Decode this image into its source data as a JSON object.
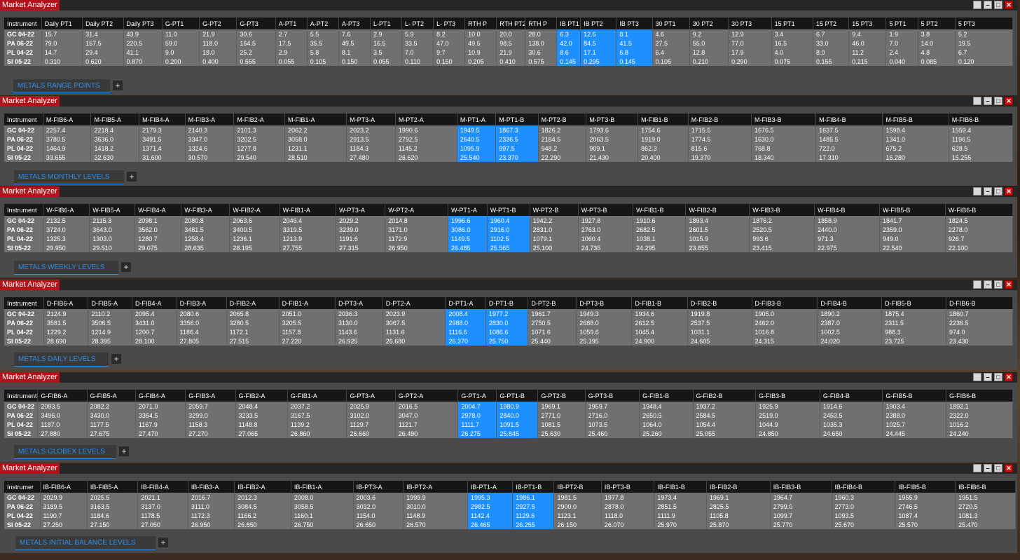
{
  "app_title": "Market Analyzer",
  "window_controls": {
    "restore": "",
    "minimize": "–",
    "maximize": "□",
    "close": "✕"
  },
  "panels": [
    {
      "tab": "METALS RANGE POINTS",
      "headers": [
        "Instrument",
        "Daily PT1",
        "Daily PT2",
        "Daily PT3",
        "G-PT1",
        "G-PT2",
        "G-PT3",
        "A-PT1",
        "A-PT2",
        "A-PT3",
        "L-PT1",
        "L- PT2",
        "L- PT3",
        "RTH P",
        "RTH PT2",
        "RTH P",
        "IB PT1",
        "IB PT2",
        "IB PT3",
        "30 PT1",
        "30 PT2",
        "30 PT3",
        "15 PT1",
        "15 PT2",
        "15 PT3",
        "5 PT1",
        "5 PT2",
        "5 PT3"
      ],
      "highlight": [
        16,
        17,
        18
      ],
      "rows": [
        [
          "GC 04-22",
          "15.7",
          "31.4",
          "43.9",
          "11.0",
          "21.9",
          "30.6",
          "2.7",
          "5.5",
          "7.6",
          "2.9",
          "5.9",
          "8.2",
          "10.0",
          "20.0",
          "28.0",
          "6.3",
          "12.6",
          "8.1",
          "4.6",
          "9.2",
          "12.9",
          "3.4",
          "6.7",
          "9.4",
          "1.9",
          "3.8",
          "5.2"
        ],
        [
          "PA 06-22",
          "79.0",
          "157.5",
          "220.5",
          "59.0",
          "118.0",
          "164.5",
          "17.5",
          "35.5",
          "49.5",
          "16.5",
          "33.5",
          "47.0",
          "49.5",
          "98.5",
          "138.0",
          "42.0",
          "84.5",
          "41.5",
          "27.5",
          "55.0",
          "77.0",
          "16.5",
          "33.0",
          "46.0",
          "7.0",
          "14.0",
          "19.5"
        ],
        [
          "PL 04-22",
          "14.7",
          "29.4",
          "41.1",
          "9.0",
          "18.0",
          "25.2",
          "2.9",
          "5.8",
          "8.1",
          "3.5",
          "7.0",
          "9.7",
          "10.9",
          "21.9",
          "30.6",
          "8.6",
          "17.1",
          "6.8",
          "6.4",
          "12.8",
          "17.9",
          "4.0",
          "8.0",
          "11.2",
          "2.4",
          "4.8",
          "6.7"
        ],
        [
          "SI 05-22",
          "0.310",
          "0.620",
          "0.870",
          "0.200",
          "0.400",
          "0.555",
          "0.055",
          "0.105",
          "0.150",
          "0.055",
          "0.110",
          "0.150",
          "0.205",
          "0.410",
          "0.575",
          "0.145",
          "0.295",
          "0.145",
          "0.105",
          "0.210",
          "0.290",
          "0.075",
          "0.155",
          "0.215",
          "0.040",
          "0.085",
          "0.120"
        ]
      ]
    },
    {
      "tab": "METALS MONTHLY LEVELS",
      "headers": [
        "Instrument",
        "M-FIB6-A",
        "M-FIB5-A",
        "M-FIB4-A",
        "M-FIB3-A",
        "M-FIB2-A",
        "M-FIB1-A",
        "M-PT3-A",
        "M-PT2-A",
        "M-PT1-A",
        "M-PT1-B",
        "M-PT2-B",
        "M-PT3-B",
        "M-FIB1-B",
        "M-FIB2-B",
        "M-FIB3-B",
        "M-FIB4-B",
        "M-FIB5-B",
        "M-FIB6-B"
      ],
      "highlight": [
        9,
        10
      ],
      "rows": [
        [
          "GC 04-22",
          "2257.4",
          "2218.4",
          "2179.3",
          "2140.3",
          "2101.3",
          "2062.2",
          "2023.2",
          "1990.6",
          "1949.5",
          "1867.3",
          "1826.2",
          "1793.6",
          "1754.6",
          "1715.5",
          "1676.5",
          "1637.5",
          "1598.4",
          "1559.4"
        ],
        [
          "PA 06-22",
          "3780.5",
          "3636.0",
          "3491.5",
          "3347.0",
          "3202.5",
          "3058.0",
          "2913.5",
          "2792.5",
          "2640.5",
          "2336.5",
          "2184.5",
          "2063.5",
          "1919.0",
          "1774.5",
          "1630.0",
          "1485.5",
          "1341.0",
          "1196.5"
        ],
        [
          "PL 04-22",
          "1464.9",
          "1418.2",
          "1371.4",
          "1324.6",
          "1277.8",
          "1231.1",
          "1184.3",
          "1145.2",
          "1095.9",
          "997.5",
          "948.2",
          "909.1",
          "862.3",
          "815.6",
          "768.8",
          "722.0",
          "675.2",
          "628.5"
        ],
        [
          "SI 05-22",
          "33.655",
          "32.630",
          "31.600",
          "30.570",
          "29.540",
          "28.510",
          "27.480",
          "26.620",
          "25.540",
          "23.370",
          "22.290",
          "21.430",
          "20.400",
          "19.370",
          "18.340",
          "17.310",
          "16.280",
          "15.255"
        ]
      ]
    },
    {
      "tab": "METALS WEEKLY LEVELS",
      "headers": [
        "Instrument",
        "W-FIB6-A",
        "W-FIB5-A",
        "W-FIB4-A",
        "W-FIB3-A",
        "W-FIB2-A",
        "W-FIB1-A",
        "W-PT3-A",
        "W-PT2-A",
        "W-PT1-A",
        "W-PT1-B",
        "W-PT2-B",
        "W-PT3-B",
        "W-FIB1-B",
        "W-FIB2-B",
        "W-FIB3-B",
        "W-FIB4-B",
        "W-FIB5-B",
        "W-FIB6-B"
      ],
      "highlight": [
        9,
        10
      ],
      "rows": [
        [
          "GC 04-22",
          "2132.5",
          "2115.3",
          "2098.1",
          "2080.8",
          "2063.6",
          "2046.4",
          "2029.2",
          "2014.8",
          "1996.6",
          "1960.4",
          "1942.2",
          "1927.8",
          "1910.6",
          "1893.4",
          "1876.2",
          "1858.9",
          "1841.7",
          "1824.5"
        ],
        [
          "PA 06-22",
          "3724.0",
          "3643.0",
          "3562.0",
          "3481.5",
          "3400.5",
          "3319.5",
          "3239.0",
          "3171.0",
          "3086.0",
          "2916.0",
          "2831.0",
          "2763.0",
          "2682.5",
          "2601.5",
          "2520.5",
          "2440.0",
          "2359.0",
          "2278.0"
        ],
        [
          "PL 04-22",
          "1325.3",
          "1303.0",
          "1280.7",
          "1258.4",
          "1236.1",
          "1213.9",
          "1191.6",
          "1172.9",
          "1149.5",
          "1102.5",
          "1079.1",
          "1060.4",
          "1038.1",
          "1015.9",
          "993.6",
          "971.3",
          "949.0",
          "926.7"
        ],
        [
          "SI 05-22",
          "29.950",
          "29.510",
          "29.075",
          "28.635",
          "28.195",
          "27.755",
          "27.315",
          "26.950",
          "26.485",
          "25.565",
          "25.100",
          "24.735",
          "24.295",
          "23.855",
          "23.415",
          "22.975",
          "22.540",
          "22.100"
        ]
      ]
    },
    {
      "tab": "METALS DAILY LEVELS",
      "headers": [
        "Instrument",
        "D-FIB6-A",
        "D-FIB5-A",
        "D-FIB4-A",
        "D-FIB3-A",
        "D-FIB2-A",
        "D-FIB1-A",
        "D-PT3-A",
        "D-PT2-A",
        "D-PT1-A",
        "D-PT1-B",
        "D-PT2-B",
        "D-PT3-B",
        "D-FIB1-B",
        "D-FIB2-B",
        "D-FIB3-B",
        "D-FIB4-B",
        "D-FIB5-B",
        "D-FIB6-B"
      ],
      "highlight": [
        9,
        10
      ],
      "rows": [
        [
          "GC 04-22",
          "2124.9",
          "2110.2",
          "2095.4",
          "2080.6",
          "2065.8",
          "2051.0",
          "2036.3",
          "2023.9",
          "2008.4",
          "1977.2",
          "1961.7",
          "1949.3",
          "1934.6",
          "1919.8",
          "1905.0",
          "1890.2",
          "1875.4",
          "1860.7"
        ],
        [
          "PA 06-22",
          "3581.5",
          "3506.5",
          "3431.0",
          "3356.0",
          "3280.5",
          "3205.5",
          "3130.0",
          "3067.5",
          "2988.0",
          "2830.0",
          "2750.5",
          "2688.0",
          "2612.5",
          "2537.5",
          "2462.0",
          "2387.0",
          "2311.5",
          "2236.5"
        ],
        [
          "PL 04-22",
          "1229.2",
          "1214.9",
          "1200.7",
          "1186.4",
          "1172.1",
          "1157.8",
          "1143.6",
          "1131.6",
          "1116.6",
          "1086.6",
          "1071.6",
          "1059.6",
          "1045.4",
          "1031.1",
          "1016.8",
          "1002.5",
          "988.3",
          "974.0"
        ],
        [
          "SI 05-22",
          "28.690",
          "28.395",
          "28.100",
          "27.805",
          "27.515",
          "27.220",
          "26.925",
          "26.680",
          "26.370",
          "25.750",
          "25.440",
          "25.195",
          "24.900",
          "24.605",
          "24.315",
          "24.020",
          "23.725",
          "23.430"
        ]
      ]
    },
    {
      "tab": "METALS GLOBEX LEVELS",
      "headers": [
        "Instrument",
        "G-FIB6-A",
        "G-FIB5-A",
        "G-FIB4-A",
        "G-FIB3-A",
        "G-FIB2-A",
        "G-FIB1-A",
        "G-PT3-A",
        "G-PT2-A",
        "G-PT1-A",
        "G-PT1-B",
        "G-PT2-B",
        "G-PT3-B",
        "G-FIB1-B",
        "G-FIB2-B",
        "G-FIB3-B",
        "G-FIB4-B",
        "G-FIB5-B",
        "G-FIB6-B"
      ],
      "highlight": [
        9,
        10
      ],
      "rows": [
        [
          "GC 04-22",
          "2093.5",
          "2082.2",
          "2071.0",
          "2059.7",
          "2048.4",
          "2037.2",
          "2025.9",
          "2016.5",
          "2004.7",
          "1980.9",
          "1969.1",
          "1959.7",
          "1948.4",
          "1937.2",
          "1925.9",
          "1914.6",
          "1903.4",
          "1892.1"
        ],
        [
          "PA 06-22",
          "3496.0",
          "3430.0",
          "3364.5",
          "3299.0",
          "3233.5",
          "3167.5",
          "3102.0",
          "3047.0",
          "2978.0",
          "2840.0",
          "2771.0",
          "2716.0",
          "2650.5",
          "2584.5",
          "2519.0",
          "2453.5",
          "2388.0",
          "2322.0"
        ],
        [
          "PL 04-22",
          "1187.0",
          "1177.5",
          "1167.9",
          "1158.3",
          "1148.8",
          "1139.2",
          "1129.7",
          "1121.7",
          "1111.7",
          "1091.5",
          "1081.5",
          "1073.5",
          "1064.0",
          "1054.4",
          "1044.9",
          "1035.3",
          "1025.7",
          "1016.2"
        ],
        [
          "SI 05-22",
          "27.880",
          "27.675",
          "27.470",
          "27.270",
          "27.065",
          "26.860",
          "26.660",
          "26.490",
          "26.275",
          "25.845",
          "25.630",
          "25.460",
          "25.260",
          "25.055",
          "24.850",
          "24.650",
          "24.445",
          "24.240"
        ]
      ]
    },
    {
      "tab": "METALS  INITIAL BALANCE LEVELS",
      "headers": [
        "Instrumer",
        "IB-FIB6-A",
        "IB-FIB5-A",
        "IB-FIB4-A",
        "IB-FIB3-A",
        "IB-FIB2-A",
        "IB-FIB1-A",
        "IB-PT3-A",
        "IB-PT2-A",
        "IB-PT1-A",
        "IB-PT1-B",
        "IB-PT2-B",
        "IB-PT3-B",
        "IB-FIB1-B",
        "IB-FIB2-B",
        "IB-FIB3-B",
        "IB-FIB4-B",
        "IB-FIB5-B",
        "IB-FIB6-B"
      ],
      "highlight": [
        9,
        10
      ],
      "rows": [
        [
          "GC 04-22",
          "2029.9",
          "2025.5",
          "2021.1",
          "2016.7",
          "2012.3",
          "2008.0",
          "2003.6",
          "1999.9",
          "1995.3",
          "1986.1",
          "1981.5",
          "1977.8",
          "1973.4",
          "1969.1",
          "1964.7",
          "1960.3",
          "1955.9",
          "1951.5"
        ],
        [
          "PA 06-22",
          "3189.5",
          "3163.5",
          "3137.0",
          "3111.0",
          "3084.5",
          "3058.5",
          "3032.0",
          "3010.0",
          "2982.5",
          "2927.5",
          "2900.0",
          "2878.0",
          "2851.5",
          "2825.5",
          "2799.0",
          "2773.0",
          "2746.5",
          "2720.5"
        ],
        [
          "PL 04-22",
          "1190.7",
          "1184.6",
          "1178.5",
          "1172.3",
          "1166.2",
          "1160.1",
          "1154.0",
          "1148.9",
          "1142.4",
          "1129.6",
          "1123.1",
          "1118.0",
          "1111.9",
          "1105.8",
          "1099.7",
          "1093.5",
          "1087.4",
          "1081.3"
        ],
        [
          "SI 05-22",
          "27.250",
          "27.150",
          "27.050",
          "26.950",
          "26.850",
          "26.750",
          "26.650",
          "26.570",
          "26.465",
          "26.255",
          "26.150",
          "26.070",
          "25.970",
          "25.870",
          "25.770",
          "25.670",
          "25.570",
          "25.470"
        ]
      ]
    }
  ]
}
